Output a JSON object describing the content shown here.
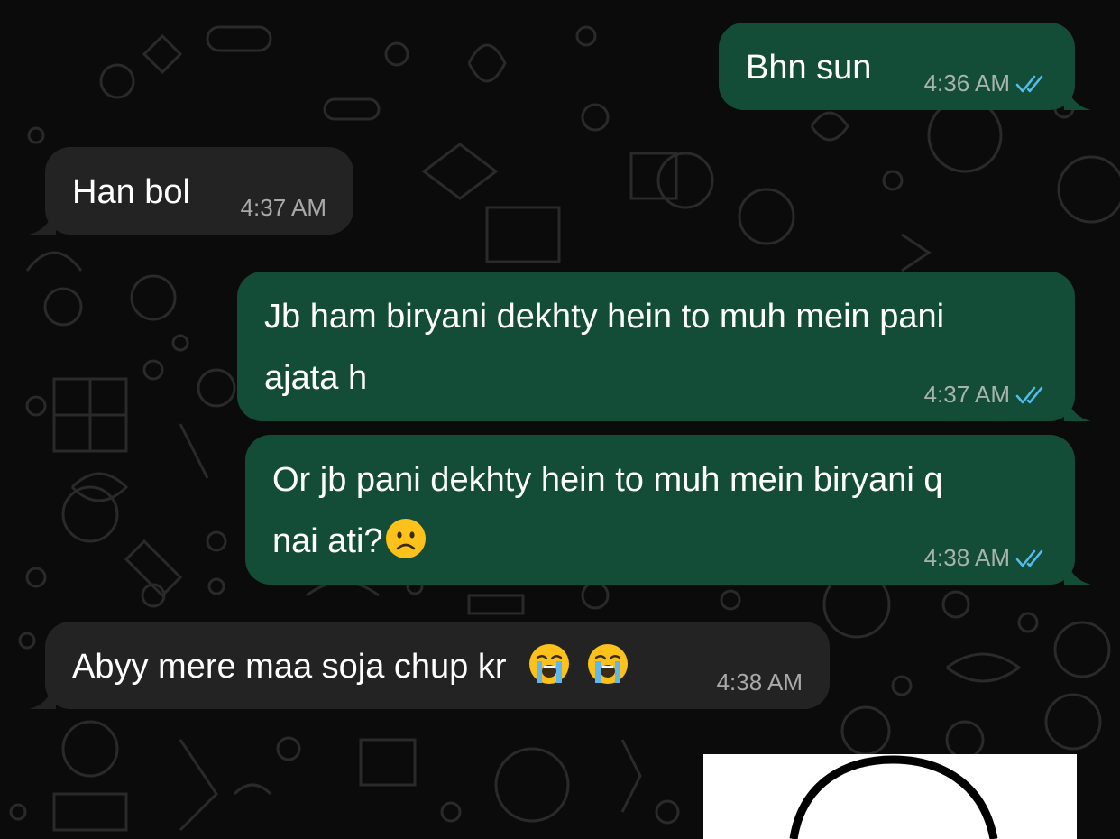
{
  "chat": {
    "messages": [
      {
        "direction": "outgoing",
        "lines": [
          "Bhn sun"
        ],
        "time": "4:36 AM",
        "status": "read-double-tick-icon"
      },
      {
        "direction": "incoming",
        "lines": [
          "Han bol"
        ],
        "time": "4:37 AM"
      },
      {
        "direction": "outgoing",
        "lines": [
          "Jb ham biryani dekhty hein to muh mein pani",
          "ajata h"
        ],
        "time": "4:37 AM",
        "status": "read-double-tick-icon"
      },
      {
        "direction": "outgoing",
        "lines": [
          "Or jb pani dekhty hein to muh mein biryani q",
          "nai ati?"
        ],
        "emoji": [
          "frowning-face-emoji"
        ],
        "time": "4:38 AM",
        "status": "read-double-tick-icon"
      },
      {
        "direction": "incoming",
        "lines": [
          "Abyy mere maa soja chup kr"
        ],
        "emoji": [
          "loudly-crying-face-emoji",
          "loudly-crying-face-emoji"
        ],
        "time": "4:38 AM"
      }
    ],
    "sticker": {
      "icon": "circle-sticker-icon"
    }
  },
  "colors": {
    "background": "#0b0b0b",
    "outgoing_bubble": "#144d37",
    "incoming_bubble": "#232323",
    "read_ticks": "#53bdeb",
    "emoji_yellow": "#fcc21b"
  }
}
